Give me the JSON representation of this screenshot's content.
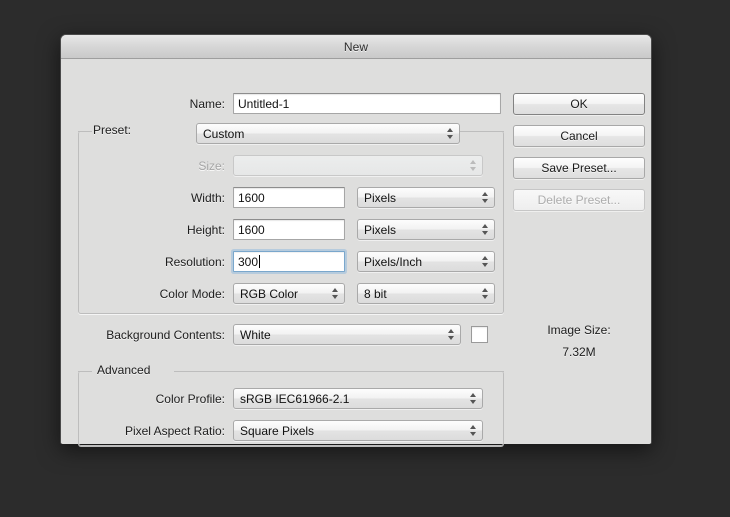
{
  "window": {
    "title": "New"
  },
  "form": {
    "name_label": "Name:",
    "name_value": "Untitled-1",
    "preset_legend": "Preset:",
    "preset_value": "Custom",
    "size_label": "Size:",
    "size_value": "",
    "width_label": "Width:",
    "width_value": "1600",
    "width_unit": "Pixels",
    "height_label": "Height:",
    "height_value": "1600",
    "height_unit": "Pixels",
    "resolution_label": "Resolution:",
    "resolution_value": "300",
    "resolution_unit": "Pixels/Inch",
    "color_mode_label": "Color Mode:",
    "color_mode_value": "RGB Color",
    "color_depth_value": "8 bit",
    "background_contents_label": "Background Contents:",
    "background_contents_value": "White",
    "background_swatch_color": "#ffffff"
  },
  "advanced": {
    "legend": "Advanced",
    "color_profile_label": "Color Profile:",
    "color_profile_value": "sRGB IEC61966-2.1",
    "pixel_aspect_ratio_label": "Pixel Aspect Ratio:",
    "pixel_aspect_ratio_value": "Square Pixels"
  },
  "buttons": {
    "ok": "OK",
    "cancel": "Cancel",
    "save_preset": "Save Preset...",
    "delete_preset": "Delete Preset..."
  },
  "image_size": {
    "label": "Image Size:",
    "value": "7.32M"
  },
  "colors": {
    "desktop": "#2c2c2c",
    "dialog_bg": "#dededd",
    "focus_ring": "#85b4de"
  }
}
